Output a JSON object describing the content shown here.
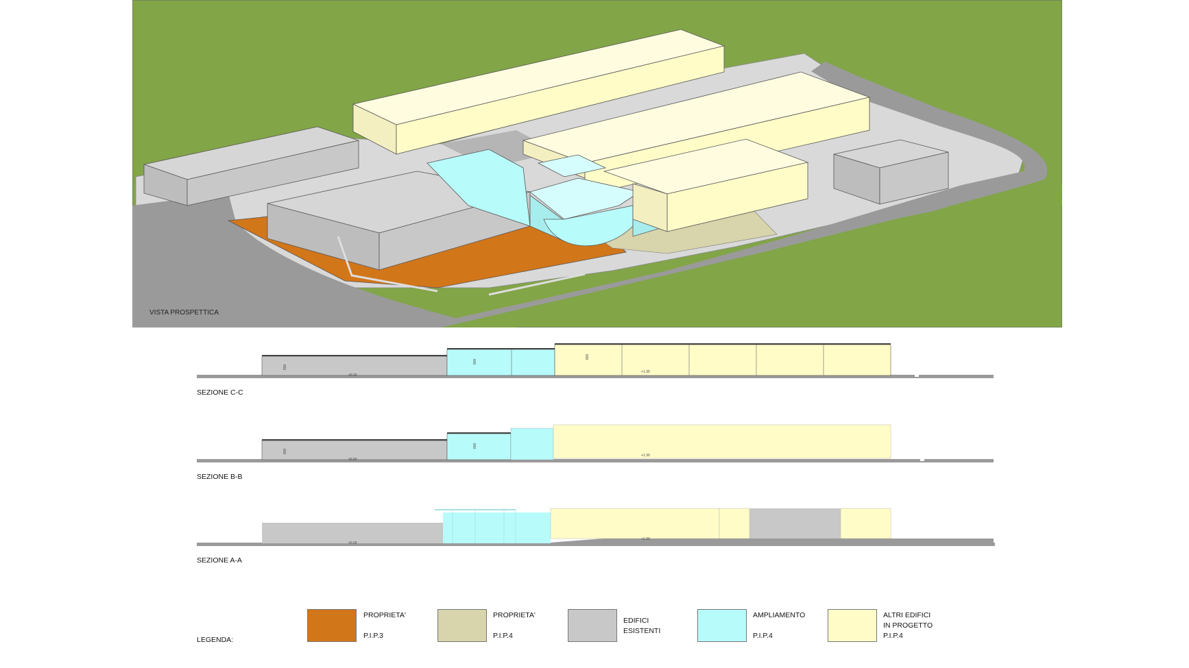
{
  "view": {
    "label": "VISTA PROSPETTICA"
  },
  "sections": [
    {
      "title": "SEZIONE C-C",
      "heights": [
        "800",
        "800",
        "800"
      ],
      "levels": [
        "±0.00",
        "+1.30"
      ]
    },
    {
      "title": "SEZIONE B-B",
      "heights": [
        "800",
        "800"
      ],
      "levels": [
        "±0.00",
        "+1.30"
      ]
    },
    {
      "title": "SEZIONE A-A",
      "levels": [
        "±0.00",
        "+1.30"
      ]
    }
  ],
  "legend": {
    "title": "LEGENDA:",
    "items": [
      {
        "line1": "PROPRIETA'",
        "line2": "",
        "line3": "P.I.P.3",
        "color": "#d2761a"
      },
      {
        "line1": "PROPRIETA'",
        "line2": "",
        "line3": "P.I.P.4",
        "color": "#d8d4ab"
      },
      {
        "line1": "EDIFICI",
        "line2": "ESISTENTI",
        "line3": "",
        "color": "#c8c8c8"
      },
      {
        "line1": "AMPLIAMENTO",
        "line2": "",
        "line3": "P.I.P.4",
        "color": "#b8fbfb"
      },
      {
        "line1": "ALTRI EDIFICI",
        "line2": "IN PROGETTO",
        "line3": "P.I.P.4",
        "color": "#fffcc8"
      }
    ]
  },
  "colors": {
    "grass": "#82a548",
    "road": "#9a9a9a",
    "paving": "#d9d9d9",
    "existing": "#c8c8c8",
    "expansion": "#b8fbfb",
    "project": "#fffcc8",
    "pip3": "#d2761a",
    "pip4": "#d8d4ab"
  }
}
